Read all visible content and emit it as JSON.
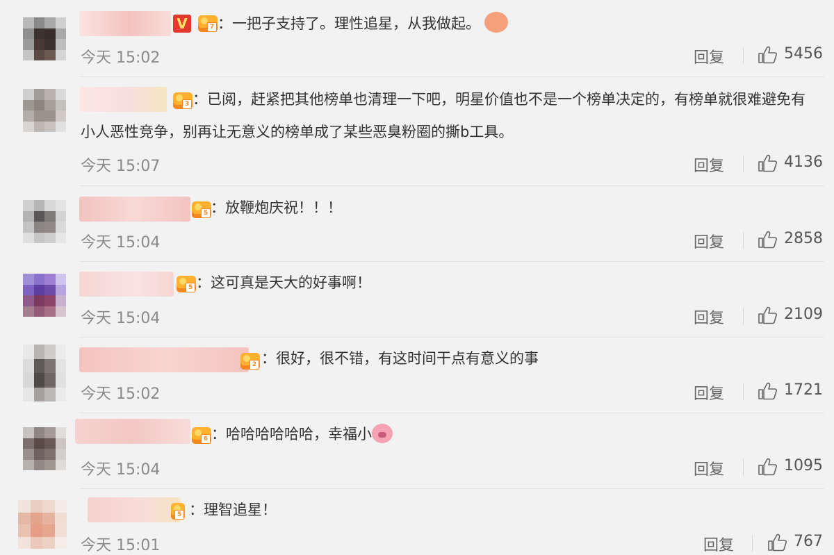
{
  "comments": [
    {
      "text": "：一把子支持了。理性追星，从我做起。",
      "time": "今天 15:02",
      "badge_level": "7",
      "likes": "5456",
      "avatar_colors": [
        "#b9b9b9",
        "#8a8a8a",
        "#a8a8a8",
        "#d0d0d0",
        "#8f8f8f",
        "#3f3330",
        "#3a2e2b",
        "#a9a9a9",
        "#9a9a9a",
        "#4a3a35",
        "#3b302c",
        "#bdbdbd",
        "#c5c5c5",
        "#5a4a44",
        "#6b5a52",
        "#d5d5d5"
      ],
      "name_colors": [
        "#f7d3d0",
        "#f3c2be"
      ],
      "verified": "V",
      "emoji": "clap-emoji"
    },
    {
      "text": "：已阅，赶紧把其他榜单也清理一下吧，明星价值也不是一个榜单决定的，有榜单就很难避免有小人恶性竞争，别再让无意义的榜单成了某些恶臭粉圈的撕b工具。",
      "time": "今天 15:07",
      "badge_level": "3",
      "likes": "4136",
      "avatar_colors": [
        "#cfcfcf",
        "#a19c96",
        "#b8b3ad",
        "#d9d9d9",
        "#9e9890",
        "#8c857d",
        "#a69f97",
        "#c4c0bb",
        "#b3aea8",
        "#9a938b",
        "#9a938b",
        "#cfcac5",
        "#d8d5d2",
        "#bdb8b3",
        "#c8c3be",
        "#e0e0e0"
      ],
      "name_colors": [
        "#f8dedb",
        "#f6e6c2"
      ]
    },
    {
      "text": "：放鞭炮庆祝！！！",
      "time": "今天 15:04",
      "badge_level": "5",
      "likes": "2858",
      "avatar_colors": [
        "#d0d0d0",
        "#b5b5b5",
        "#d8d8d8",
        "#e3e3e3",
        "#b3b3b3",
        "#585656",
        "#7e7b7a",
        "#d4d4d4",
        "#c4c4c4",
        "#8a8584",
        "#908a88",
        "#dadada",
        "#dfdfdf",
        "#c6c6c6",
        "#cecece",
        "#e6e6e6"
      ],
      "name_colors": [
        "#f3c3c0",
        "#f8d9d6"
      ]
    },
    {
      "text": "：这可真是天大的好事啊！",
      "time": "今天 15:04",
      "badge_level": "5",
      "likes": "2109",
      "avatar_colors": [
        "#9e8fd6",
        "#8a73cc",
        "#9f7fd3",
        "#cfc4ee",
        "#7e63c0",
        "#5c3fa0",
        "#6b4aa8",
        "#b5a6e2",
        "#8f5a8a",
        "#7c3a5e",
        "#8e4468",
        "#c8b0cf",
        "#a57e90",
        "#945c74",
        "#a86f86",
        "#d6c5cf"
      ],
      "name_colors": [
        "#f6d6d3",
        "#f9e3e1"
      ]
    },
    {
      "text": "：很好，很不错，有这时间干点有意义的事",
      "time": "今天 15:02",
      "badge_level": "2",
      "likes": "1721",
      "avatar_colors": [
        "#e8e8e8",
        "#b9b5b3",
        "#cfcccb",
        "#ececec",
        "#dcdcdc",
        "#5e5856",
        "#7b7573",
        "#e2e2e2",
        "#d8d8d8",
        "#4f4947",
        "#6d6765",
        "#e0e0e0",
        "#e6e6e6",
        "#a5a09e",
        "#bcb8b6",
        "#eaeaea"
      ],
      "name_colors": [
        "#f4c4c0",
        "#f8d4d0"
      ]
    },
    {
      "text": "：哈哈哈哈哈哈，幸福小",
      "time": "今天 15:04",
      "badge_level": "6",
      "likes": "1095",
      "avatar_colors": [
        "#c7c3c1",
        "#8f8582",
        "#a59a96",
        "#e0dedd",
        "#7d6f6b",
        "#5a4b47",
        "#6a5a55",
        "#cbc6c4",
        "#9a8f8b",
        "#70635f",
        "#7e706b",
        "#d3cfcd",
        "#b7b0ad",
        "#938884",
        "#a0958f",
        "#dedbd9"
      ],
      "name_colors": [
        "#f6d2cf",
        "#f3c7c4"
      ],
      "emoji": "pig-emoji"
    },
    {
      "text": "：理智追星！",
      "time": "今天 15:01",
      "badge_level": "5",
      "likes": "767",
      "avatar_colors": [
        "#efe3dc",
        "#e8cfc2",
        "#efd9cf",
        "#f4ebe6",
        "#e5b9a6",
        "#e2a48c",
        "#e6b39e",
        "#f0ded5",
        "#e9c2b1",
        "#e79c86",
        "#e6a791",
        "#f1dfd7",
        "#f1e3dc",
        "#ebc8b9",
        "#edd1c5",
        "#f5ece8"
      ],
      "name_colors": [
        "#f6d1ce",
        "#f6e4c2"
      ]
    }
  ],
  "reply_label": "回复",
  "like_icon": "thumbs-up-icon"
}
